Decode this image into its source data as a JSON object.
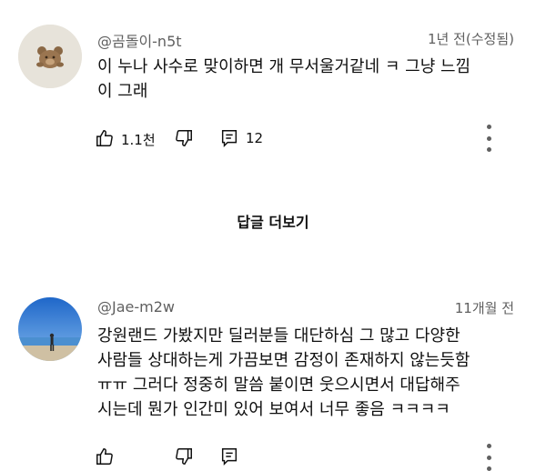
{
  "comments": [
    {
      "username": "@곰돌이-n5t",
      "time": "1년 전(수정됨)",
      "text": "이 누나 사수로 맞이하면 개 무서울거같네 ㅋ 그냥 느낌\n이 그래",
      "likes": "1.1천",
      "replies": "12"
    },
    {
      "username": "@Jae-m2w",
      "time": "11개월 전",
      "text": "강원랜드 가봤지만 딜러분들 대단하심 그 많고 다양한\n사람들 상대하는게 가끔보면 감정이 존재하지 않는듯함\nㅠㅠ 그러다 정중히 말씀 붙이면 웃으시면서 대답해주\n시는데 뭔가 인간미 있어 보여서 너무 좋음 ㅋㅋㅋㅋ",
      "likes": "",
      "replies": ""
    }
  ],
  "more_replies_label": "답글 더보기",
  "icons": {
    "like": "thumbs-up-icon",
    "dislike": "thumbs-down-icon",
    "reply": "comment-icon",
    "menu": "more-vert-icon"
  },
  "colors": {
    "text": "#0f0f0f",
    "secondary": "#606060",
    "background": "#ffffff"
  }
}
